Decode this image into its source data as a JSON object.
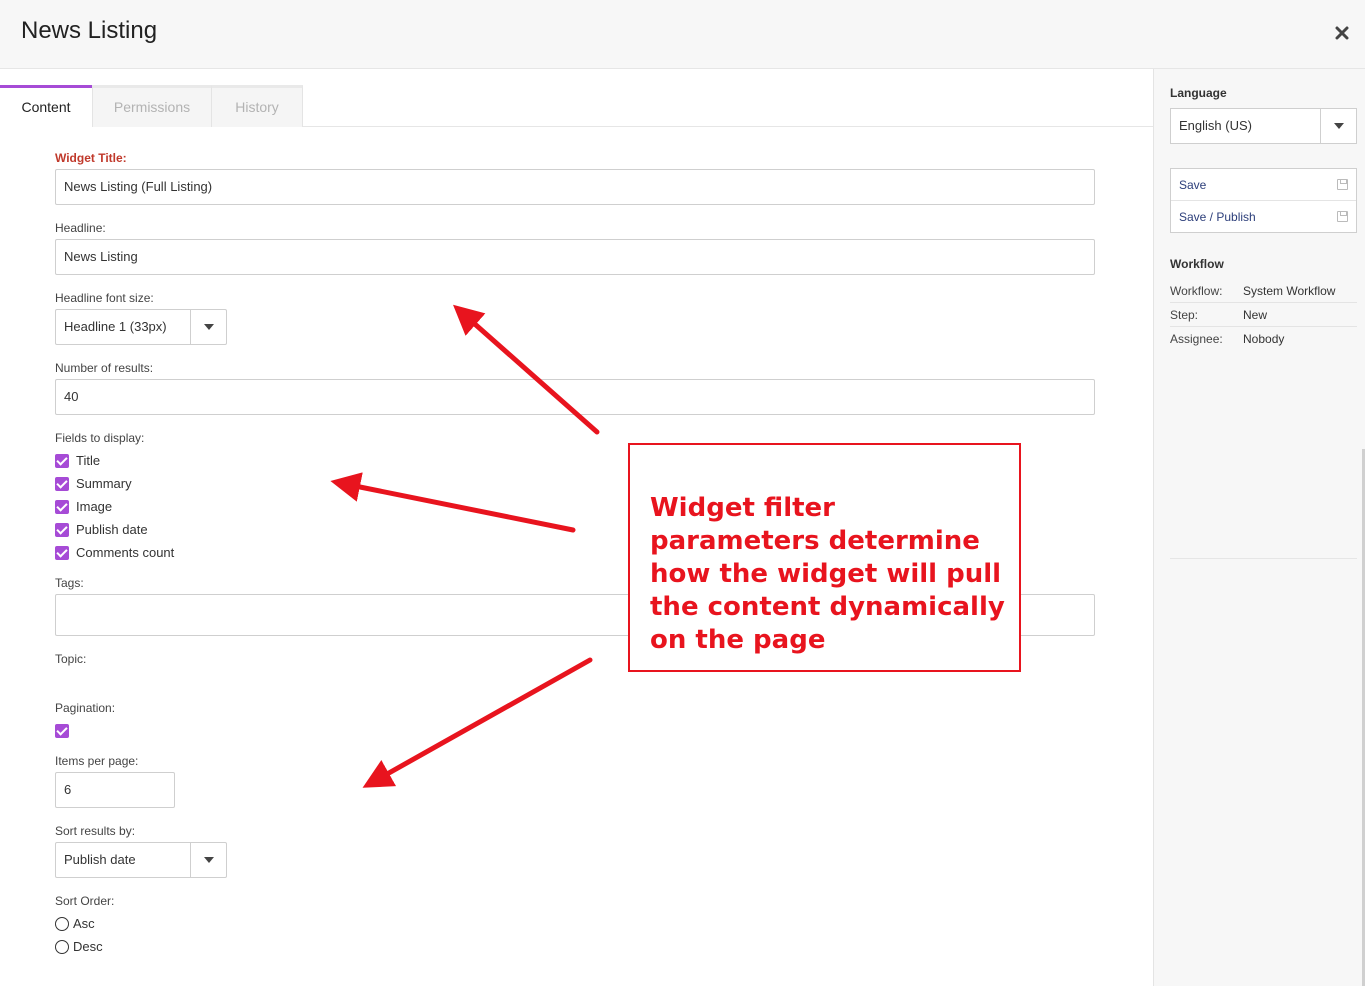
{
  "modal": {
    "title": "News Listing"
  },
  "tabs": [
    {
      "label": "Content",
      "active": true
    },
    {
      "label": "Permissions",
      "active": false
    },
    {
      "label": "History",
      "active": false
    }
  ],
  "form": {
    "widget_title": {
      "label": "Widget Title:",
      "value": "News Listing (Full Listing)"
    },
    "headline": {
      "label": "Headline:",
      "value": "News Listing"
    },
    "headline_font_size": {
      "label": "Headline font size:",
      "value": "Headline 1 (33px)"
    },
    "number_of_results": {
      "label": "Number of results:",
      "value": "40"
    },
    "fields_to_display": {
      "label": "Fields to display:",
      "options": [
        {
          "label": "Title",
          "checked": true
        },
        {
          "label": "Summary",
          "checked": true
        },
        {
          "label": "Image",
          "checked": true
        },
        {
          "label": "Publish date",
          "checked": true
        },
        {
          "label": "Comments count",
          "checked": true
        }
      ]
    },
    "tags": {
      "label": "Tags:",
      "value": ""
    },
    "topic": {
      "label": "Topic:"
    },
    "pagination": {
      "label": "Pagination:",
      "checked": true
    },
    "items_per_page": {
      "label": "Items per page:",
      "value": "6"
    },
    "sort_results_by": {
      "label": "Sort results by:",
      "value": "Publish date"
    },
    "sort_order": {
      "label": "Sort Order:",
      "options": [
        {
          "label": "Asc",
          "selected": false
        },
        {
          "label": "Desc",
          "selected": false
        }
      ]
    }
  },
  "sidebar": {
    "language": {
      "heading": "Language",
      "value": "English (US)"
    },
    "actions": [
      {
        "label": "Save",
        "icon": "floppy-disk-icon"
      },
      {
        "label": "Save / Publish",
        "icon": "floppy-disk-icon"
      }
    ],
    "workflow": {
      "heading": "Workflow",
      "rows": [
        {
          "key": "Workflow:",
          "value": "System Workflow"
        },
        {
          "key": "Step:",
          "value": "New"
        },
        {
          "key": "Assignee:",
          "value": "Nobody"
        }
      ]
    }
  },
  "annotation": {
    "text": "Widget filter parameters determine how the widget will pull the content dynamically on the page",
    "color": "#e8141e"
  },
  "colors": {
    "accent": "#a64bd6",
    "required": "#c0392b",
    "link": "#2c3e7a"
  }
}
